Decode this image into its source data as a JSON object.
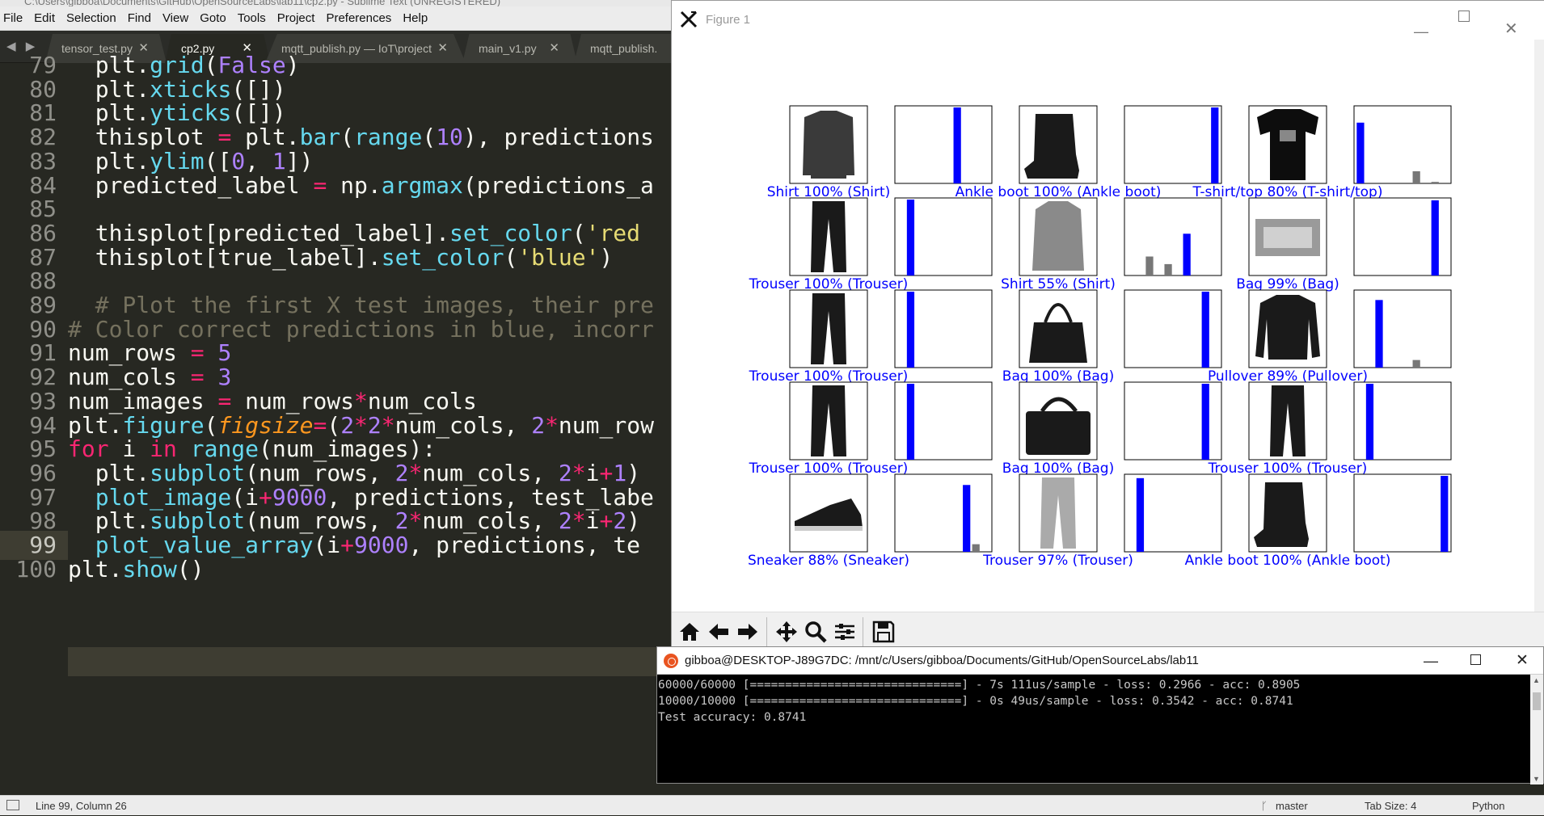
{
  "editor": {
    "window_title": "C:\\Users\\gibboa\\Documents\\GitHub\\OpenSourceLabs\\lab11\\cp2.py - Sublime Text (UNREGISTERED)",
    "menu": [
      "File",
      "Edit",
      "Selection",
      "Find",
      "View",
      "Goto",
      "Tools",
      "Project",
      "Preferences",
      "Help"
    ],
    "tabs": [
      {
        "label": "tensor_test.py",
        "active": false
      },
      {
        "label": "cp2.py",
        "active": true
      },
      {
        "label": "mqtt_publish.py — IoT\\project",
        "active": false
      },
      {
        "label": "main_v1.py",
        "active": false
      },
      {
        "label": "mqtt_publish.",
        "active": false
      }
    ],
    "tab_close": "✕",
    "tab_nav": "◀ ▶",
    "line_numbers": [
      "79",
      "80",
      "81",
      "82",
      "83",
      "84",
      "85",
      "86",
      "87",
      "88",
      "89",
      "90",
      "91",
      "92",
      "93",
      "94",
      "95",
      "96",
      "97",
      "98",
      "99",
      "100"
    ],
    "current_line": "99",
    "lines": [
      [
        [
          "  plt.",
          ""
        ],
        [
          "grid",
          "p"
        ],
        [
          "(",
          ""
        ],
        [
          "False",
          "c"
        ],
        [
          ")",
          ""
        ]
      ],
      [
        [
          "  plt.",
          ""
        ],
        [
          "xticks",
          "p"
        ],
        [
          "([])",
          ""
        ]
      ],
      [
        [
          "  plt.",
          ""
        ],
        [
          "yticks",
          "p"
        ],
        [
          "([])",
          ""
        ]
      ],
      [
        [
          "  thisplot ",
          ""
        ],
        [
          "=",
          "o"
        ],
        [
          " plt.",
          ""
        ],
        [
          "bar",
          "p"
        ],
        [
          "(",
          ""
        ],
        [
          "range",
          "p"
        ],
        [
          "(",
          ""
        ],
        [
          "10",
          "c"
        ],
        [
          "), predictions",
          ""
        ]
      ],
      [
        [
          "  plt.",
          ""
        ],
        [
          "ylim",
          "p"
        ],
        [
          "([",
          ""
        ],
        [
          "0",
          "c"
        ],
        [
          ", ",
          ""
        ],
        [
          "1",
          "c"
        ],
        [
          "])",
          ""
        ]
      ],
      [
        [
          "  predicted_label ",
          ""
        ],
        [
          "=",
          "o"
        ],
        [
          " np.",
          ""
        ],
        [
          "argmax",
          "p"
        ],
        [
          "(predictions_a",
          ""
        ]
      ],
      [
        [
          "",
          ""
        ]
      ],
      [
        [
          "  thisplot[predicted_label].",
          ""
        ],
        [
          "set_color",
          "p"
        ],
        [
          "(",
          ""
        ],
        [
          "'red",
          "s"
        ]
      ],
      [
        [
          "  thisplot[true_label].",
          ""
        ],
        [
          "set_color",
          "p"
        ],
        [
          "(",
          ""
        ],
        [
          "'blue'",
          "s"
        ],
        [
          ")",
          ""
        ]
      ],
      [
        [
          "",
          ""
        ]
      ],
      [
        [
          "  # Plot the first X test images, their pre",
          "cm"
        ]
      ],
      [
        [
          "# Color correct predictions in blue, incorr",
          "cm"
        ]
      ],
      [
        [
          "num_rows ",
          ""
        ],
        [
          "=",
          "o"
        ],
        [
          " ",
          ""
        ],
        [
          "5",
          "c"
        ]
      ],
      [
        [
          "num_cols ",
          ""
        ],
        [
          "=",
          "o"
        ],
        [
          " ",
          ""
        ],
        [
          "3",
          "c"
        ]
      ],
      [
        [
          "num_images ",
          ""
        ],
        [
          "=",
          "o"
        ],
        [
          " num_rows",
          ""
        ],
        [
          "*",
          "o"
        ],
        [
          "num_cols",
          ""
        ]
      ],
      [
        [
          "plt.",
          ""
        ],
        [
          "figure",
          "p"
        ],
        [
          "(",
          ""
        ],
        [
          "figsize",
          "a"
        ],
        [
          "=",
          "o"
        ],
        [
          "(",
          ""
        ],
        [
          "2",
          "c"
        ],
        [
          "*",
          "o"
        ],
        [
          "2",
          "c"
        ],
        [
          "*",
          "o"
        ],
        [
          "num_cols, ",
          ""
        ],
        [
          "2",
          "c"
        ],
        [
          "*",
          "o"
        ],
        [
          "num_row",
          ""
        ]
      ],
      [
        [
          "for",
          "o"
        ],
        [
          " i ",
          ""
        ],
        [
          "in",
          "o"
        ],
        [
          " ",
          ""
        ],
        [
          "range",
          "p"
        ],
        [
          "(num_images):",
          ""
        ]
      ],
      [
        [
          "  plt.",
          ""
        ],
        [
          "subplot",
          "p"
        ],
        [
          "(num_rows, ",
          ""
        ],
        [
          "2",
          "c"
        ],
        [
          "*",
          "o"
        ],
        [
          "num_cols, ",
          ""
        ],
        [
          "2",
          "c"
        ],
        [
          "*",
          "o"
        ],
        [
          "i",
          ""
        ],
        [
          "+",
          "o"
        ],
        [
          "1",
          "c"
        ],
        [
          ")",
          ""
        ]
      ],
      [
        [
          "  ",
          ""
        ],
        [
          "plot_image",
          "p"
        ],
        [
          "(i",
          ""
        ],
        [
          "+",
          "o"
        ],
        [
          "9000",
          "c"
        ],
        [
          ", predictions, test_labe",
          ""
        ]
      ],
      [
        [
          "  plt.",
          ""
        ],
        [
          "subplot",
          "p"
        ],
        [
          "(num_rows, ",
          ""
        ],
        [
          "2",
          "c"
        ],
        [
          "*",
          "o"
        ],
        [
          "num_cols, ",
          ""
        ],
        [
          "2",
          "c"
        ],
        [
          "*",
          "o"
        ],
        [
          "i",
          ""
        ],
        [
          "+",
          "o"
        ],
        [
          "2",
          "c"
        ],
        [
          ")",
          ""
        ]
      ],
      [
        [
          "  ",
          ""
        ],
        [
          "plot_value_array",
          "p"
        ],
        [
          "(i",
          ""
        ],
        [
          "+",
          "o"
        ],
        [
          "9000",
          "c"
        ],
        [
          ", predictions, te",
          ""
        ]
      ],
      [
        [
          "plt.",
          ""
        ],
        [
          "show",
          "p"
        ],
        [
          "()",
          ""
        ]
      ]
    ],
    "status": {
      "position": "Line 99, Column 26",
      "branch": "master",
      "tab_size": "Tab Size: 4",
      "syntax": "Python"
    }
  },
  "figure": {
    "window_title": "Figure 1",
    "colors": {
      "label": "#0000ff",
      "bar_highlight": "#0000ff",
      "bar_other": "#777777"
    },
    "plots": [
      {
        "label": "Shirt 100% (Shirt)",
        "item": "shirt",
        "bars": [
          0,
          0,
          0,
          0,
          0,
          0,
          1,
          0,
          0,
          0
        ],
        "pred": 6
      },
      {
        "label": "Ankle boot 100% (Ankle boot)",
        "item": "boot",
        "bars": [
          0,
          0,
          0,
          0,
          0,
          0,
          0,
          0,
          0,
          1
        ],
        "pred": 9
      },
      {
        "label": "T-shirt/top 80% (T-shirt/top)",
        "item": "tshirt",
        "bars": [
          0.8,
          0,
          0,
          0,
          0,
          0,
          0.16,
          0,
          0.02,
          0
        ],
        "pred": 0
      },
      {
        "label": "Trouser 100% (Trouser)",
        "item": "trouser",
        "bars": [
          0,
          1,
          0,
          0,
          0,
          0,
          0,
          0,
          0,
          0
        ],
        "pred": 1
      },
      {
        "label": "Shirt 55% (Shirt)",
        "item": "coat",
        "bars": [
          0,
          0,
          0.25,
          0,
          0.15,
          0,
          0.55,
          0,
          0,
          0
        ],
        "pred": 6
      },
      {
        "label": "Bag 99% (Bag)",
        "item": "bag-flat",
        "bars": [
          0,
          0,
          0,
          0,
          0,
          0,
          0,
          0,
          0.99,
          0
        ],
        "pred": 8
      },
      {
        "label": "Trouser 100% (Trouser)",
        "item": "trouser",
        "bars": [
          0,
          1,
          0,
          0,
          0,
          0,
          0,
          0,
          0,
          0
        ],
        "pred": 1
      },
      {
        "label": "Bag 100% (Bag)",
        "item": "tote",
        "bars": [
          0,
          0,
          0,
          0,
          0,
          0,
          0,
          0,
          1,
          0
        ],
        "pred": 8
      },
      {
        "label": "Pullover 89% (Pullover)",
        "item": "pullover",
        "bars": [
          0,
          0,
          0.89,
          0,
          0,
          0,
          0.1,
          0,
          0,
          0
        ],
        "pred": 2
      },
      {
        "label": "Trouser 100% (Trouser)",
        "item": "trouser",
        "bars": [
          0,
          1,
          0,
          0,
          0,
          0,
          0,
          0,
          0,
          0
        ],
        "pred": 1
      },
      {
        "label": "Bag 100% (Bag)",
        "item": "handbag",
        "bars": [
          0,
          0,
          0,
          0,
          0,
          0,
          0,
          0,
          1,
          0
        ],
        "pred": 8
      },
      {
        "label": "Trouser 100% (Trouser)",
        "item": "trouser",
        "bars": [
          0,
          1,
          0,
          0,
          0,
          0,
          0,
          0,
          0,
          0
        ],
        "pred": 1
      },
      {
        "label": "Sneaker 88% (Sneaker)",
        "item": "sneaker",
        "bars": [
          0,
          0,
          0,
          0,
          0,
          0,
          0,
          0.88,
          0.1,
          0
        ],
        "pred": 7
      },
      {
        "label": "Trouser 97% (Trouser)",
        "item": "trouser-light",
        "bars": [
          0,
          0.97,
          0,
          0,
          0,
          0,
          0,
          0,
          0,
          0
        ],
        "pred": 1
      },
      {
        "label": "Ankle boot 100% (Ankle boot)",
        "item": "boot",
        "bars": [
          0,
          0,
          0,
          0,
          0,
          0,
          0,
          0,
          0,
          1
        ],
        "pred": 9
      }
    ],
    "toolbar": [
      "home-icon",
      "back-icon",
      "forward-icon",
      "pan-icon",
      "zoom-icon",
      "configure-icon",
      "save-icon"
    ]
  },
  "terminal": {
    "window_title": "gibboa@DESKTOP-J89G7DC: /mnt/c/Users/gibboa/Documents/GitHub/OpenSourceLabs/lab11",
    "lines": [
      "60000/60000 [==============================] - 7s 111us/sample - loss: 0.2966 - acc: 0.8905",
      "10000/10000 [==============================] - 0s 49us/sample - loss: 0.3542 - acc: 0.8741",
      "Test accuracy: 0.8741"
    ]
  }
}
